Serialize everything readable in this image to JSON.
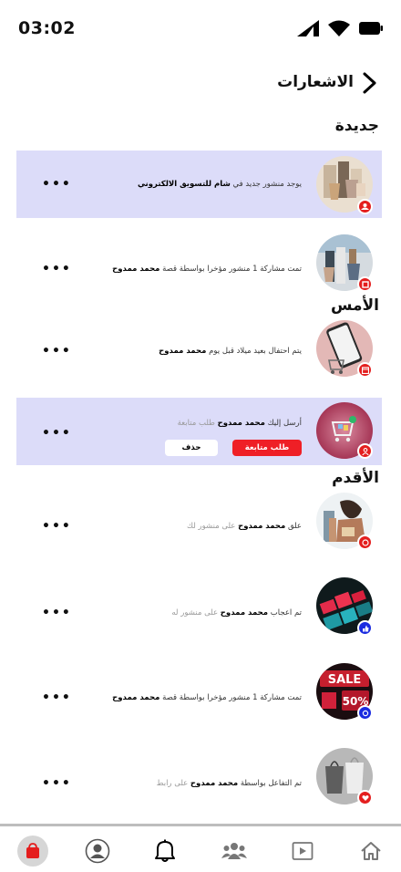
{
  "status": {
    "time": "03:02"
  },
  "header": {
    "title": "الاشعارات"
  },
  "sections": {
    "new": "جديدة",
    "yesterday": "الأمس",
    "older": "الأقدم"
  },
  "notifications": [
    {
      "pre": "يوجد منشور جديد في ",
      "bold": "شام للتسويق الالكتروني",
      "post": "",
      "badge": "group-icon",
      "badge_color": "#e41e1e"
    },
    {
      "pre": "تمت مشاركة 1 منشور مؤخرا بواسطة قصة ",
      "bold": "محمد ممدوح",
      "post": "",
      "badge": "share-icon",
      "badge_color": "#e41e1e"
    },
    {
      "pre": "يتم احتفال بعيد ميلاد قبل يوم ",
      "bold": "محمد ممدوح",
      "post": "",
      "badge": "calendar-icon",
      "badge_color": "#e41e1e"
    },
    {
      "pre": "أرسل إليك ",
      "bold": "محمد ممدوح",
      "post": " طلب متابعة",
      "badge": "person-icon",
      "badge_color": "#e41e1e",
      "accept": "طلب متابعة",
      "delete": "حذف"
    },
    {
      "pre": "علق ",
      "bold": "محمد ممدوح",
      "post": " على منشور لك",
      "badge": "comment-icon",
      "badge_color": "#e41e1e"
    },
    {
      "pre": "تم اعجاب ",
      "bold": "محمد ممدوح",
      "post": " على منشور له",
      "badge": "like-icon",
      "badge_color": "#1a2be0"
    },
    {
      "pre": "تمت مشاركة 1 منشور مؤخرا بواسطة قصة ",
      "bold": "محمد ممدوح",
      "post": "",
      "badge": "share-icon",
      "badge_color": "#1a2be0"
    },
    {
      "pre": "تم التفاعل بواسطة ",
      "bold": "محمد ممدوح",
      "post": " على رابط",
      "badge": "heart-icon",
      "badge_color": "#e41e1e"
    }
  ],
  "more_label": "•••",
  "image_text": {
    "sale": "SALE",
    "discount": "50%"
  },
  "nav": [
    "shopping-bag-icon",
    "profile-icon",
    "bell-icon",
    "groups-icon",
    "video-icon",
    "home-icon"
  ]
}
